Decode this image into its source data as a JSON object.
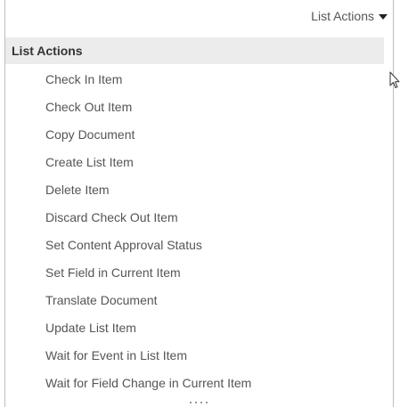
{
  "dropdown": {
    "label": "List Actions",
    "icon": "caret-down-icon"
  },
  "menu": {
    "header": "List Actions",
    "items": [
      {
        "label": "Check In Item"
      },
      {
        "label": "Check Out Item"
      },
      {
        "label": "Copy Document"
      },
      {
        "label": "Create List Item"
      },
      {
        "label": "Delete Item"
      },
      {
        "label": "Discard Check Out Item"
      },
      {
        "label": "Set Content Approval Status"
      },
      {
        "label": "Set Field in Current Item"
      },
      {
        "label": "Translate Document"
      },
      {
        "label": "Update List Item"
      },
      {
        "label": "Wait for Event in List Item"
      },
      {
        "label": "Wait for Field Change in Current Item"
      }
    ]
  },
  "icons": {
    "cursor": "mouse-pointer-icon",
    "resize": "resize-grip-icon"
  },
  "colors": {
    "header_background": "#ececec",
    "text": "#555555",
    "border": "#bdbdbd"
  }
}
